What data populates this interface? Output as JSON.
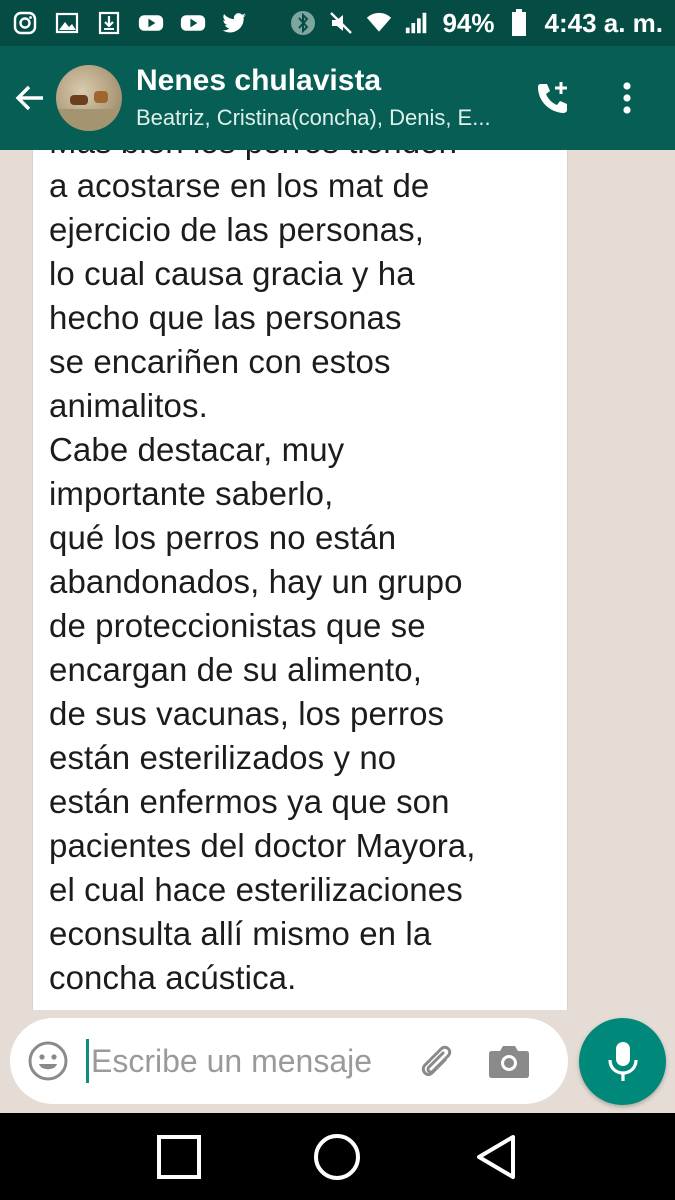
{
  "status_bar": {
    "battery": "94%",
    "time": "4:43 a. m.",
    "left_icons": [
      "instagram-icon",
      "gallery-icon",
      "download-icon",
      "youtube-icon",
      "youtube-icon",
      "twitter-icon"
    ],
    "right_icons": [
      "bluetooth-icon",
      "mute-icon",
      "wifi-icon",
      "signal-icon",
      "battery-icon"
    ]
  },
  "header": {
    "title": "Nenes chulavista",
    "subtitle": "Beatriz, Cristina(concha), Denis, E...",
    "actions": [
      "add-call-icon",
      "more-vert-icon"
    ],
    "color": "#075e54"
  },
  "message": {
    "text": "Más bien los perros tienden\na acostarse en los mat de\nejercicio de las personas,\nlo cual causa gracia y ha\nhecho que las personas\nse encariñen con estos\nanimalitos.\nCabe destacar, muy\nimportante saberlo,\nqué los perros no están\nabandonados, hay un grupo\nde proteccionistas que se\nencargan de su alimento,\nde sus vacunas, los perros\nestán esterilizados y no\nestán enfermos ya que son\npacientes del doctor Mayora,\nel cual hace esterilizaciones\neconsulta allí mismo en la\nconcha acústica."
  },
  "composer": {
    "placeholder": "Escribe un mensaje",
    "accent": "#00897b"
  },
  "nav": {
    "buttons": [
      "recents-icon",
      "home-icon",
      "back-icon"
    ]
  }
}
